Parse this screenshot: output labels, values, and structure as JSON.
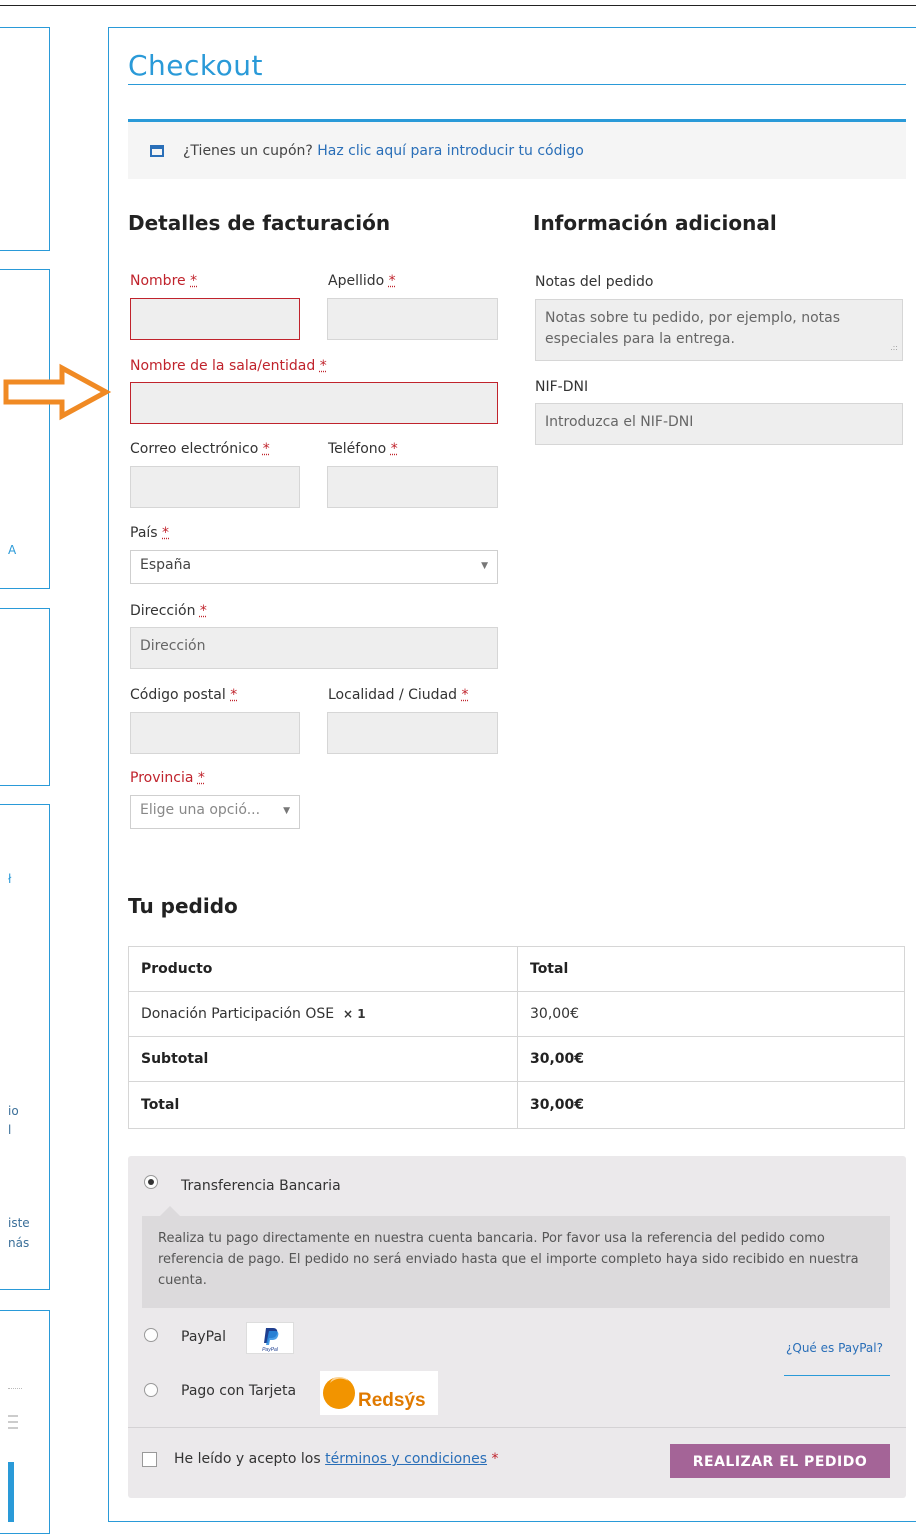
{
  "page": {
    "title": "Checkout"
  },
  "coupon": {
    "prompt": "¿Tienes un cupón?",
    "link": "Haz clic aquí para introducir tu código"
  },
  "billing": {
    "heading": "Detalles de facturación",
    "required_mark": "*",
    "fields": {
      "first_name": {
        "label": "Nombre"
      },
      "last_name": {
        "label": "Apellido"
      },
      "company": {
        "label": "Nombre de la sala/entidad"
      },
      "email": {
        "label": "Correo electrónico"
      },
      "phone": {
        "label": "Teléfono"
      },
      "country": {
        "label": "País",
        "value": "España"
      },
      "address": {
        "label": "Dirección",
        "placeholder": "Dirección"
      },
      "postcode": {
        "label": "Código postal"
      },
      "city": {
        "label": "Localidad / Ciudad"
      },
      "state": {
        "label": "Provincia",
        "value": "Elige una opció..."
      }
    }
  },
  "additional": {
    "heading": "Información adicional",
    "notes_label": "Notas del pedido",
    "notes_placeholder": "Notas sobre tu pedido, por ejemplo, notas especiales para la entrega.",
    "nif_label": "NIF-DNI",
    "nif_placeholder": "Introduzca el NIF-DNI"
  },
  "order": {
    "heading": "Tu pedido",
    "columns": [
      "Producto",
      "Total"
    ],
    "item": {
      "name": "Donación Participación OSE",
      "qty": "× 1",
      "total": "30,00€"
    },
    "subtotal": {
      "label": "Subtotal",
      "value": "30,00€"
    },
    "total": {
      "label": "Total",
      "value": "30,00€"
    }
  },
  "payment": {
    "methods": [
      {
        "label": "Transferencia Bancaria",
        "selected": true
      },
      {
        "label": "PayPal",
        "selected": false
      },
      {
        "label": "Pago con Tarjeta",
        "selected": false
      }
    ],
    "bank_description": "Realiza tu pago directamente en nuestra cuenta bancaria. Por favor usa la referencia del pedido como referencia de pago. El pedido no será enviado hasta que el importe completo haya sido recibido en nuestra cuenta.",
    "paypal_link": "¿Qué es PayPal?",
    "paypal_logo_text": "PayPal",
    "redsys_logo_text": "Redsýs",
    "terms_prefix": "He leído y acepto los",
    "terms_link": "términos y condiciones",
    "place_order": "REALIZAR EL PEDIDO"
  },
  "sidebar_fragments": [
    "A",
    "ł",
    "io",
    "l",
    "iste",
    "nás"
  ],
  "colors": {
    "accent": "#2a9ad8",
    "error": "#c0232c",
    "button": "#a46497",
    "arrow": "#f08a24"
  }
}
